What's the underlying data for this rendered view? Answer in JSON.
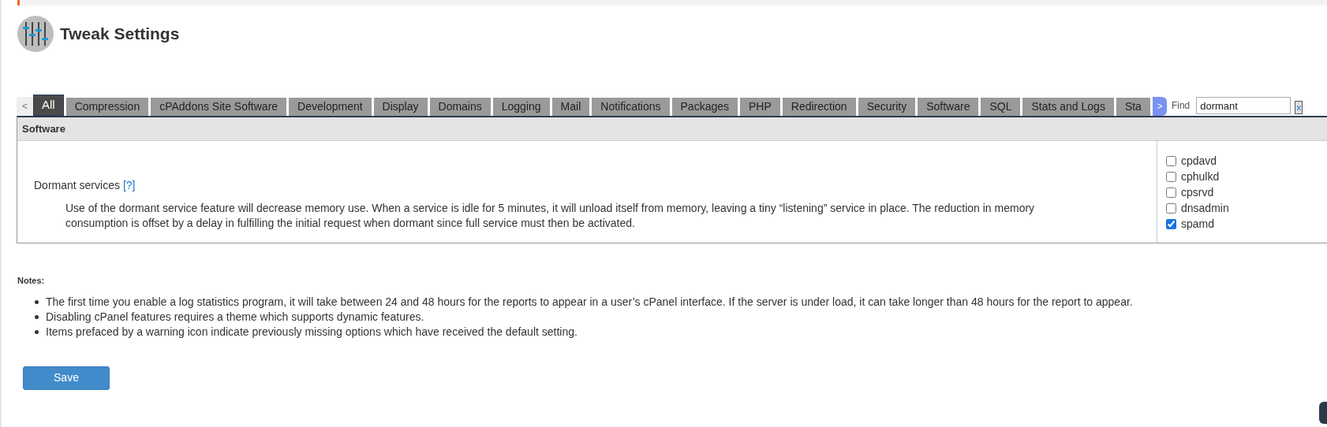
{
  "page_title": "Tweak Settings",
  "tabs": [
    {
      "label": "All",
      "selected": true
    },
    {
      "label": "Compression",
      "selected": false
    },
    {
      "label": "cPAddons Site Software",
      "selected": false
    },
    {
      "label": "Development",
      "selected": false
    },
    {
      "label": "Display",
      "selected": false
    },
    {
      "label": "Domains",
      "selected": false
    },
    {
      "label": "Logging",
      "selected": false
    },
    {
      "label": "Mail",
      "selected": false
    },
    {
      "label": "Notifications",
      "selected": false
    },
    {
      "label": "Packages",
      "selected": false
    },
    {
      "label": "PHP",
      "selected": false
    },
    {
      "label": "Redirection",
      "selected": false
    },
    {
      "label": "Security",
      "selected": false
    },
    {
      "label": "Software",
      "selected": false
    },
    {
      "label": "SQL",
      "selected": false
    },
    {
      "label": "Stats and Logs",
      "selected": false
    },
    {
      "label": "Sta",
      "selected": false
    }
  ],
  "tab_prev": "<",
  "tab_next": ">",
  "find": {
    "label": "Find",
    "value": "dormant",
    "clear": "x"
  },
  "section": {
    "title": "Software",
    "setting": {
      "name": "Dormant services",
      "help": "[?]",
      "description": "Use of the dormant service feature will decrease memory use. When a service is idle for 5 minutes, it will unload itself from memory, leaving a tiny “listening” service in place. The reduction in memory consumption is offset by a delay in fulfilling the initial request when dormant since full service must then be activated.",
      "options": [
        {
          "label": "cpdavd",
          "checked": false
        },
        {
          "label": "cphulkd",
          "checked": false
        },
        {
          "label": "cpsrvd",
          "checked": false
        },
        {
          "label": "dnsadmin",
          "checked": false
        },
        {
          "label": "spamd",
          "checked": true
        }
      ]
    }
  },
  "notes": {
    "title": "Notes:",
    "items": [
      "The first time you enable a log statistics program, it will take between 24 and 48 hours for the reports to appear in a user’s cPanel interface. If the server is under load, it can take longer than 48 hours for the report to appear.",
      "Disabling cPanel features requires a theme which supports dynamic features.",
      "Items prefaced by a warning icon indicate previously missing options which have received the default setting."
    ]
  },
  "save_button": "Save"
}
